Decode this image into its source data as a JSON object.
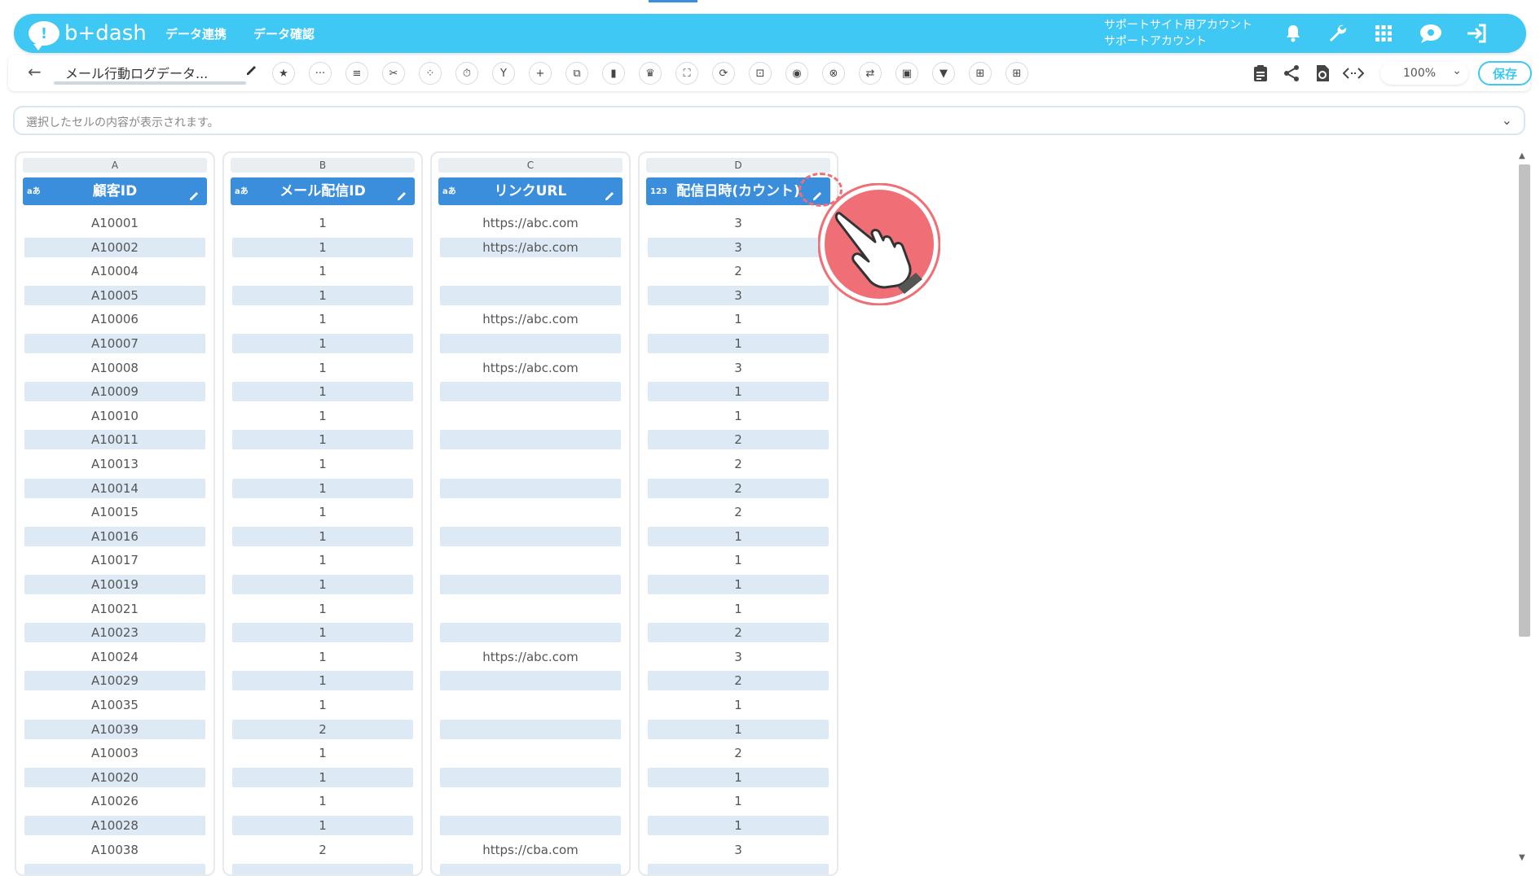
{
  "app": {
    "logo_text": "b+dash",
    "nav": [
      "データ連携",
      "データ確認"
    ],
    "account_line1": "サポートサイト用アカウント",
    "account_line2": "サポートアカウント"
  },
  "toolbar": {
    "back": "←",
    "file_title": "メール行動ログデータ...",
    "zoom": "100%",
    "save_label": "保存"
  },
  "cellbar": {
    "placeholder": "選択したセルの内容が表示されます。"
  },
  "columns": [
    {
      "letter": "A",
      "type_badge": "aあ",
      "header": "顧客ID",
      "cells": [
        "A10001",
        "A10002",
        "A10004",
        "A10005",
        "A10006",
        "A10007",
        "A10008",
        "A10009",
        "A10010",
        "A10011",
        "A10013",
        "A10014",
        "A10015",
        "A10016",
        "A10017",
        "A10019",
        "A10021",
        "A10023",
        "A10024",
        "A10029",
        "A10035",
        "A10039",
        "A10003",
        "A10020",
        "A10026",
        "A10028",
        "A10038",
        ""
      ]
    },
    {
      "letter": "B",
      "type_badge": "aあ",
      "header": "メール配信ID",
      "cells": [
        "1",
        "1",
        "1",
        "1",
        "1",
        "1",
        "1",
        "1",
        "1",
        "1",
        "1",
        "1",
        "1",
        "1",
        "1",
        "1",
        "1",
        "1",
        "1",
        "1",
        "1",
        "2",
        "1",
        "1",
        "1",
        "1",
        "2",
        ""
      ]
    },
    {
      "letter": "C",
      "type_badge": "aあ",
      "header": "リンクURL",
      "cells": [
        "https://abc.com",
        "https://abc.com",
        "",
        "",
        "https://abc.com",
        "",
        "https://abc.com",
        "",
        "",
        "",
        "",
        "",
        "",
        "",
        "",
        "",
        "",
        "",
        "https://abc.com",
        "",
        "",
        "",
        "",
        "",
        "",
        "",
        "https://cba.com",
        ""
      ]
    },
    {
      "letter": "D",
      "type_badge": "123",
      "header": "配信日時(カウント)",
      "cells": [
        "3",
        "3",
        "2",
        "3",
        "1",
        "1",
        "3",
        "1",
        "1",
        "2",
        "2",
        "2",
        "2",
        "1",
        "1",
        "1",
        "1",
        "2",
        "3",
        "2",
        "1",
        "1",
        "2",
        "1",
        "1",
        "1",
        "3",
        ""
      ]
    }
  ],
  "colors": {
    "brand": "#3ec8f3",
    "header_blue": "#3a8edb",
    "row_shade": "#dde9f5",
    "cursor_red": "#f06f76"
  }
}
